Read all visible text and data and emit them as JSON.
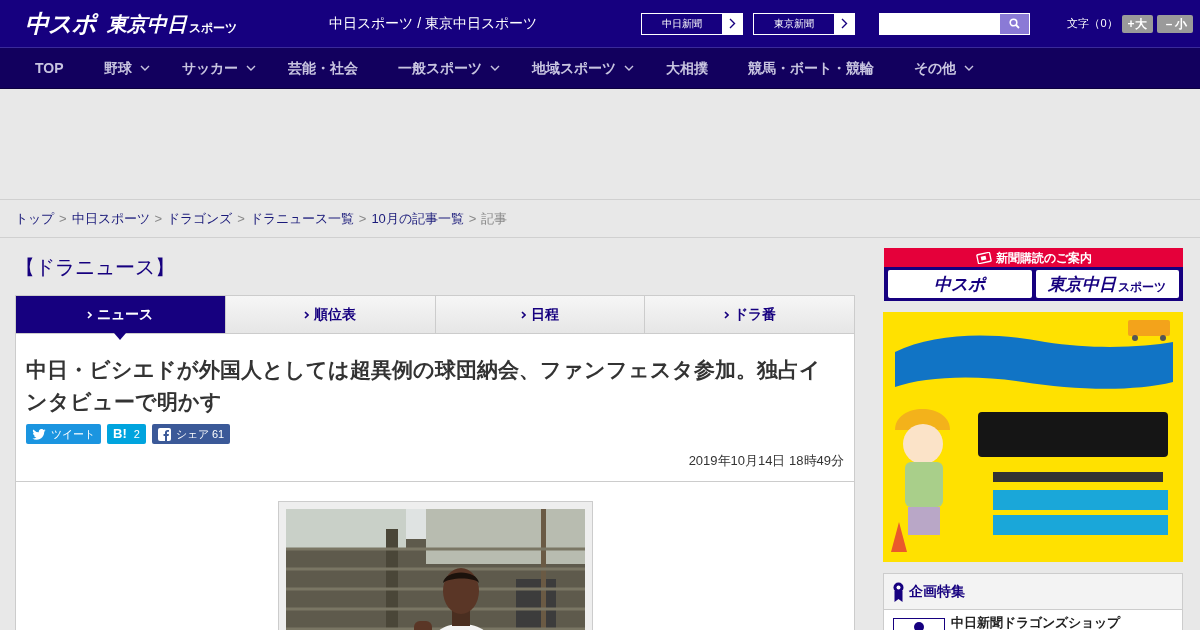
{
  "header": {
    "logo": "中スポ",
    "logo_2": {
      "main": "東京中日",
      "sub": "スポーツ"
    },
    "site_title": "中日スポーツ / 東京中日スポーツ",
    "paper_links": [
      "中日新聞",
      "東京新聞"
    ],
    "font_size": {
      "label": "文字（0）",
      "buttons": [
        "+大",
        "－小"
      ]
    }
  },
  "nav": [
    {
      "label": "TOP",
      "dropdown": false
    },
    {
      "label": "野球",
      "dropdown": true
    },
    {
      "label": "サッカー",
      "dropdown": true
    },
    {
      "label": "芸能・社会",
      "dropdown": false
    },
    {
      "label": "一般スポーツ",
      "dropdown": true
    },
    {
      "label": "地域スポーツ",
      "dropdown": true
    },
    {
      "label": "大相撲",
      "dropdown": false
    },
    {
      "label": "競馬・ボート・競輪",
      "dropdown": false
    },
    {
      "label": "その他",
      "dropdown": true
    }
  ],
  "breadcrumb": [
    {
      "kind": "link",
      "label": "トップ"
    },
    {
      "kind": "separator",
      "label": ">"
    },
    {
      "kind": "link",
      "label": "中日スポーツ"
    },
    {
      "kind": "separator",
      "label": ">"
    },
    {
      "kind": "link",
      "label": "ドラゴンズ"
    },
    {
      "kind": "separator",
      "label": ">"
    },
    {
      "kind": "link",
      "label": "ドラニュース一覧"
    },
    {
      "kind": "separator",
      "label": ">"
    },
    {
      "kind": "link",
      "label": "10月の記事一覧"
    },
    {
      "kind": "separator",
      "label": ">"
    },
    {
      "kind": "current",
      "label": "記事"
    }
  ],
  "section_title": "【ドラニュース】",
  "tabs": [
    {
      "label": "ニュース",
      "selected": true
    },
    {
      "label": "順位表",
      "selected": false
    },
    {
      "label": "日程",
      "selected": false
    },
    {
      "label": "ドラ番",
      "selected": false
    }
  ],
  "article": {
    "title": "中日・ビシエドが外国人としては超異例の球団納会、ファンフェスタ参加。独占インタビューで明かす",
    "share": [
      {
        "kind": "twitter",
        "label": "ツイート"
      },
      {
        "kind": "hatena",
        "icon_text": "B!",
        "label": "2"
      },
      {
        "kind": "facebook",
        "label": "シェア 61"
      }
    ],
    "date": "2019年10月14日 18時49分"
  },
  "sidebar": {
    "subscribe": {
      "heading": "新聞購読のご案内",
      "logos": [
        "中スポ",
        "東京中日"
      ],
      "logo_2_sub": "スポーツ"
    },
    "features": {
      "title": "企画特集",
      "items": [
        "中日新聞ドラゴンズショップ"
      ]
    }
  }
}
